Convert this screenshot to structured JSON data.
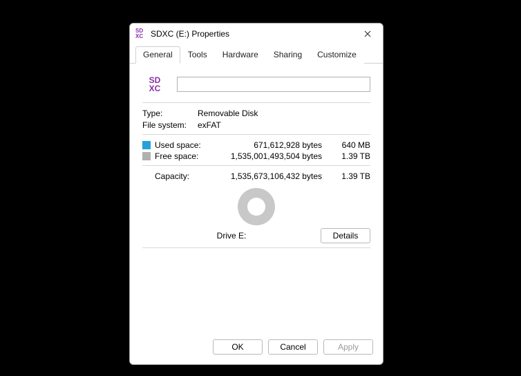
{
  "window": {
    "title": "SDXC (E:) Properties"
  },
  "tabs": {
    "general": "General",
    "tools": "Tools",
    "hardware": "Hardware",
    "sharing": "Sharing",
    "customize": "Customize"
  },
  "general": {
    "label_value": "",
    "type_key": "Type:",
    "type_val": "Removable Disk",
    "fs_key": "File system:",
    "fs_val": "exFAT",
    "used_label": "Used space:",
    "used_bytes": "671,612,928 bytes",
    "used_hr": "640 MB",
    "free_label": "Free space:",
    "free_bytes": "1,535,001,493,504 bytes",
    "free_hr": "1.39 TB",
    "capacity_label": "Capacity:",
    "capacity_bytes": "1,535,673,106,432 bytes",
    "capacity_hr": "1.39 TB",
    "drive_label": "Drive E:",
    "details_btn": "Details"
  },
  "footer": {
    "ok": "OK",
    "cancel": "Cancel",
    "apply": "Apply"
  },
  "colors": {
    "used": "#26a0da",
    "free": "#b0b0b0"
  },
  "chart_data": {
    "type": "pie",
    "title": "Drive E:",
    "series": [
      {
        "name": "Used space",
        "value": 671612928,
        "color": "#26a0da"
      },
      {
        "name": "Free space",
        "value": 1535001493504,
        "color": "#c8c8c8"
      }
    ],
    "total": 1535673106432
  }
}
